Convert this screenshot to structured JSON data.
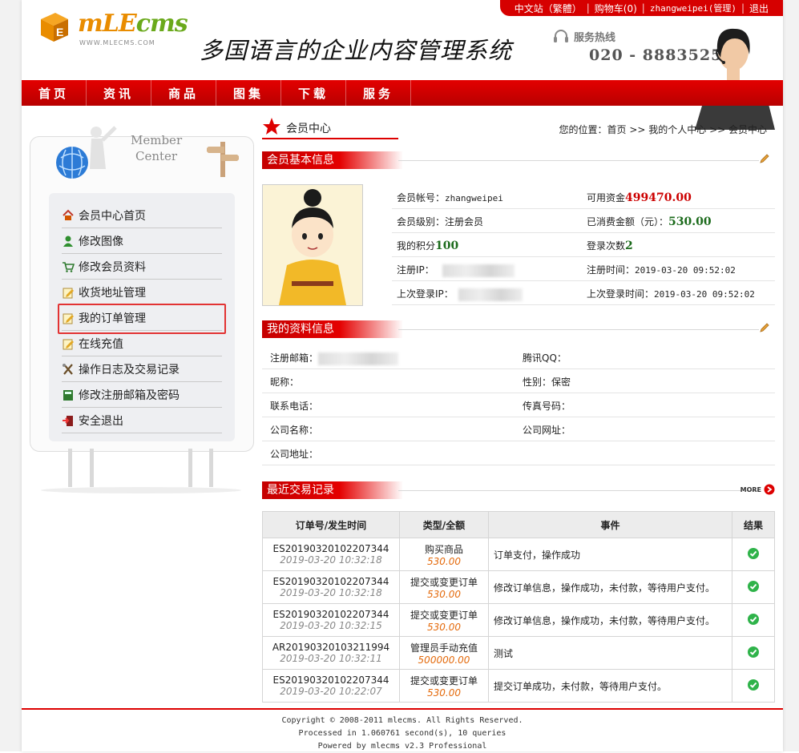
{
  "topbar": {
    "lang": "中文站（繁體）",
    "cart": "购物车(0)",
    "user": "zhangweipei(管理)",
    "logout": "退出"
  },
  "brand": {
    "logo_main": "mLE",
    "logo_cms": "cms",
    "logo_url": "WWW.MLECMS.COM",
    "slogan": "多国语言的企业内容管理系统"
  },
  "hotline": {
    "label": "服务热线",
    "number": "020 - 88835256"
  },
  "nav": [
    "首页",
    "资讯",
    "商品",
    "图集",
    "下载",
    "服务"
  ],
  "sidebar": {
    "member_title": "Member",
    "member_sub": "Center",
    "items": [
      {
        "label": "会员中心首页",
        "icon": "home-icon"
      },
      {
        "label": "修改图像",
        "icon": "user-icon"
      },
      {
        "label": "修改会员资料",
        "icon": "cart-icon"
      },
      {
        "label": "收货地址管理",
        "icon": "note-edit-icon"
      },
      {
        "label": "我的订单管理",
        "icon": "note-edit-icon"
      },
      {
        "label": "在线充值",
        "icon": "note-edit-icon"
      },
      {
        "label": "操作日志及交易记录",
        "icon": "tools-icon"
      },
      {
        "label": "修改注册邮箱及密码",
        "icon": "book-icon"
      },
      {
        "label": "安全退出",
        "icon": "exit-icon"
      }
    ]
  },
  "page": {
    "title": "会员中心",
    "breadcrumb": "您的位置：首页 >> 我的个人中心 >> 会员中心"
  },
  "basic": {
    "heading": "会员基本信息",
    "account_label": "会员帐号：",
    "account": "zhangweipei",
    "funds_label": "可用资金",
    "funds": "499470.00",
    "level_label": "会员级别：注册会员",
    "spent_label": "已消费金额（元）：",
    "spent": "530.00",
    "points_label": "我的积分",
    "points": "100",
    "logins_label": "登录次数",
    "logins": "2",
    "reg_ip_label": "注册IP：",
    "reg_time_label": "注册时间：",
    "reg_time": "2019-03-20 09:52:02",
    "last_ip_label": "上次登录IP：",
    "last_time_label": "上次登录时间：",
    "last_time": "2019-03-20 09:52:02"
  },
  "profile": {
    "heading": "我的资料信息",
    "email_label": "注册邮箱：",
    "qq_label": "腾讯QQ：",
    "nick_label": "昵称：",
    "gender_label": "性别：保密",
    "phone_label": "联系电话：",
    "fax_label": "传真号码：",
    "company_label": "公司名称：",
    "site_label": "公司网址：",
    "addr_label": "公司地址："
  },
  "transactions": {
    "heading": "最近交易记录",
    "more": "MORE",
    "columns": [
      "订单号/发生时间",
      "类型/全额",
      "事件",
      "结果"
    ],
    "rows": [
      {
        "id": "ES20190320102207344",
        "time": "2019-03-20 10:32:18",
        "type": "购买商品",
        "amount": "530.00",
        "event": "订单支付，操作成功"
      },
      {
        "id": "ES20190320102207344",
        "time": "2019-03-20 10:32:18",
        "type": "提交或变更订单",
        "amount": "530.00",
        "event": "修改订单信息，操作成功，未付款，等待用户支付。"
      },
      {
        "id": "ES20190320102207344",
        "time": "2019-03-20 10:32:15",
        "type": "提交或变更订单",
        "amount": "530.00",
        "event": "修改订单信息，操作成功，未付款，等待用户支付。"
      },
      {
        "id": "AR20190320103211994",
        "time": "2019-03-20 10:32:11",
        "type": "管理员手动充值",
        "amount": "500000.00",
        "event": "测试"
      },
      {
        "id": "ES20190320102207344",
        "time": "2019-03-20 10:22:07",
        "type": "提交或变更订单",
        "amount": "530.00",
        "event": "提交订单成功，未付款，等待用户支付。"
      }
    ]
  },
  "footer": {
    "copyright": "Copyright © 2008-2011 mlecms. All Rights Reserved.",
    "processed": "Processed in 1.060761 second(s), 10 queries",
    "powered": "Powered by mlecms v2.3 Professional"
  },
  "colors": {
    "brand_red": "#d60000",
    "money_red": "#cc0000",
    "green": "#1c6b1c",
    "orange": "#e46a0c"
  }
}
